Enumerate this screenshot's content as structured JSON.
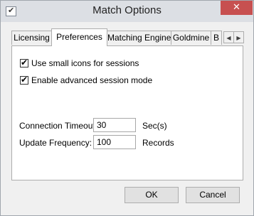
{
  "window": {
    "title": "Match Options",
    "close_symbol": "✕"
  },
  "tabs": [
    {
      "label": "Licensing"
    },
    {
      "label": "Preferences"
    },
    {
      "label": "Matching Engine"
    },
    {
      "label": "Goldmine"
    },
    {
      "label": "B"
    }
  ],
  "tab_scroll": {
    "left": "◀",
    "right": "▶"
  },
  "preferences": {
    "small_icons": {
      "label": "Use small icons for sessions",
      "checked": true
    },
    "advanced_mode": {
      "label": "Enable advanced session mode",
      "checked": true
    },
    "connection_timeout": {
      "label": "Connection Timeout:",
      "value": "30",
      "unit": "Sec(s)"
    },
    "update_frequency": {
      "label": "Update Frequency:",
      "value": "100",
      "unit": "Records"
    }
  },
  "buttons": {
    "ok": "OK",
    "cancel": "Cancel"
  },
  "icons": {
    "app": "app-check-icon",
    "check_mark": "✔"
  }
}
